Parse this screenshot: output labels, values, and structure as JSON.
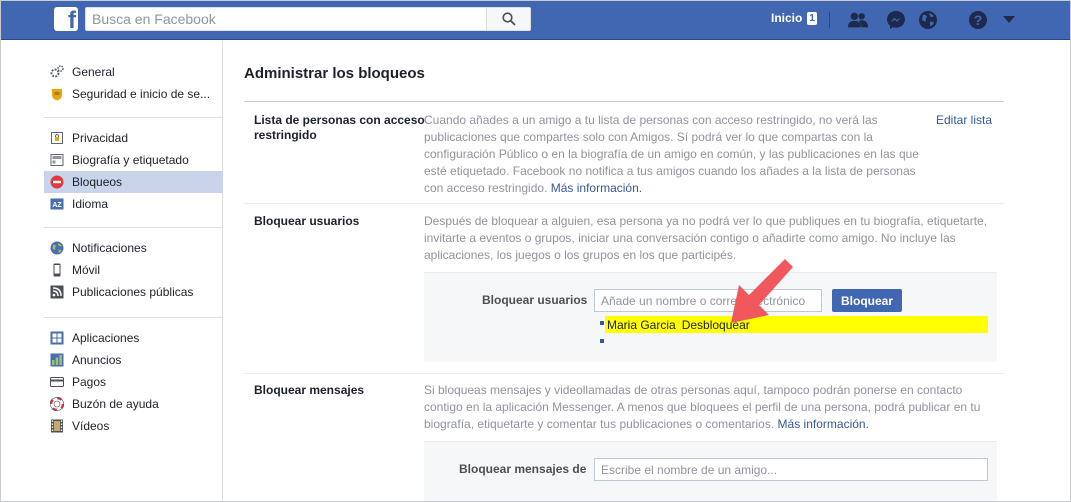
{
  "topbar": {
    "logo_letter": "f",
    "search_placeholder": "Busca en Facebook",
    "home_label": "Inicio",
    "home_badge": "1",
    "icons": [
      "friend-requests-icon",
      "messenger-icon",
      "notifications-globe-icon",
      "help-icon",
      "account-menu-icon"
    ],
    "brand_color": "#4267b2"
  },
  "sidebar": {
    "groups": [
      [
        {
          "label": "General",
          "icon": "gears-icon"
        },
        {
          "label": "Seguridad e inicio de se...",
          "icon": "security-badge-icon"
        }
      ],
      [
        {
          "label": "Privacidad",
          "icon": "privacy-lock-icon"
        },
        {
          "label": "Biografía y etiquetado",
          "icon": "timeline-icon"
        },
        {
          "label": "Bloqueos",
          "icon": "block-icon",
          "active": true
        },
        {
          "label": "Idioma",
          "icon": "language-icon"
        }
      ],
      [
        {
          "label": "Notificaciones",
          "icon": "globe-icon"
        },
        {
          "label": "Móvil",
          "icon": "mobile-icon"
        },
        {
          "label": "Publicaciones públicas",
          "icon": "rss-icon"
        }
      ],
      [
        {
          "label": "Aplicaciones",
          "icon": "apps-icon"
        },
        {
          "label": "Anuncios",
          "icon": "ads-icon"
        },
        {
          "label": "Pagos",
          "icon": "payments-card-icon"
        },
        {
          "label": "Buzón de ayuda",
          "icon": "lifebuoy-icon"
        },
        {
          "label": "Vídeos",
          "icon": "film-icon"
        }
      ]
    ]
  },
  "main": {
    "title": "Administrar los bloqueos",
    "restricted": {
      "label_line1": "Lista de personas con acceso",
      "label_line2": "restringido",
      "text_lines": [
        "Cuando añades a un amigo a tu lista de personas con acceso restringido, no verá las",
        "publicaciones que compartes solo con Amigos. Sí podrá ver lo que compartas con la",
        "configuración Público o en la biografía de un amigo en común, y las publicaciones en las que",
        "esté etiquetado. Facebook no notifica a tus amigos cuando los añades a la lista de personas"
      ],
      "text_last": "con acceso restringido.",
      "more_link": "Más información.",
      "edit_link": "Editar lista"
    },
    "block_users": {
      "label": "Bloquear usuarios",
      "text_lines": [
        "Después de bloquear a alguien, esa persona ya no podrá ver lo que publiques en tu biografía, etiquetarte,",
        "invitarte a eventos o grupos, iniciar una conversación contigo o añadirte como amigo. No incluye las",
        "aplicaciones, los juegos o los grupos en los que participés."
      ],
      "field_label": "Bloquear usuarios",
      "input_placeholder": "Añade un nombre o correo electrónico",
      "button_label": "Bloquear",
      "blocked": [
        {
          "name": "Maria Garcia",
          "action": "Desbloquear"
        }
      ],
      "highlight_color": "#ffff00"
    },
    "block_messages": {
      "label": "Bloquear mensajes",
      "text_lines": [
        "Si bloqueas mensajes y videollamadas de otras personas aquí, tampoco podrán ponerse en contacto",
        "contigo en la aplicación Messenger. A menos que bloquees el perfil de una persona, podrá publicar en tu",
        "biografía, etiquetarte y comentar tus publicaciones o comentarios."
      ],
      "more_link": "Más información.",
      "field_label": "Bloquear mensajes de",
      "input_placeholder": "Escribe el nombre de un amigo..."
    },
    "annotation_arrow_color": "#f0585d"
  }
}
